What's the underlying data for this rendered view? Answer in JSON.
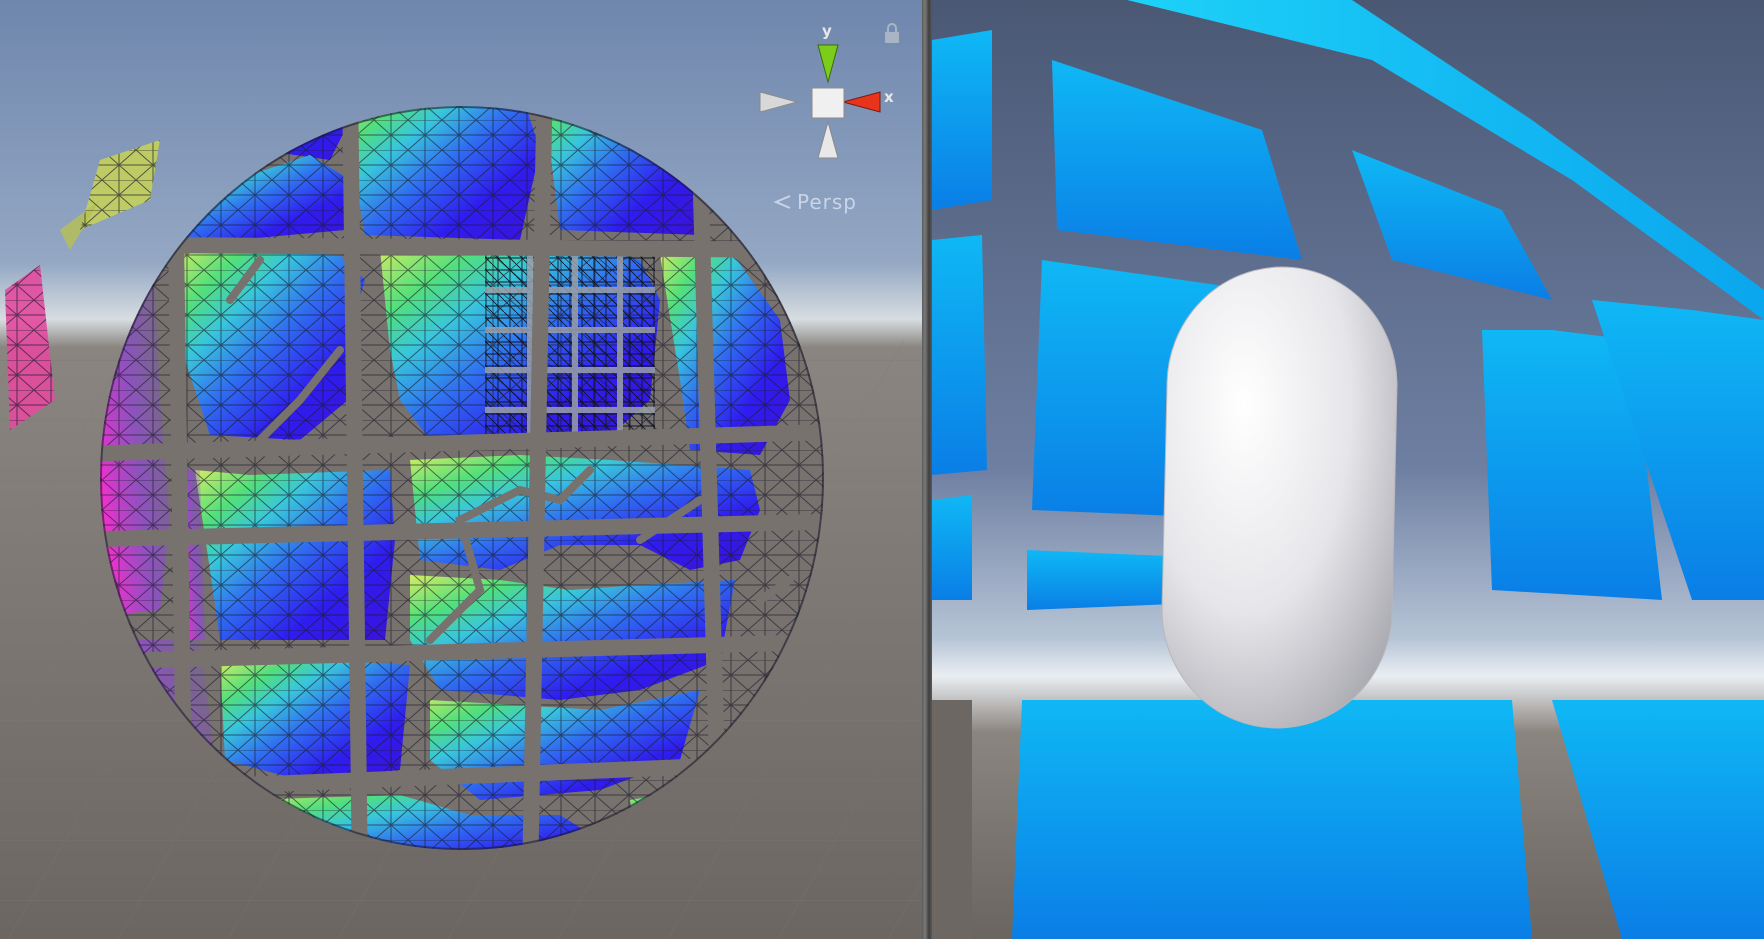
{
  "scene_view": {
    "projection_label": "Persp",
    "gizmo": {
      "y_axis_label": "y",
      "x_axis_label": "x",
      "y_color": "#7ccc1a",
      "x_color": "#e8341a",
      "neutral_color": "#d8d8d8"
    },
    "lock_icon": "lock-icon",
    "sky_color": "#7e93b8",
    "ground_color": "#6c6662"
  },
  "game_view": {
    "sky_color": "#4b5a78",
    "panel_color": "#14a0f0",
    "capsule_color": "#ececec"
  }
}
